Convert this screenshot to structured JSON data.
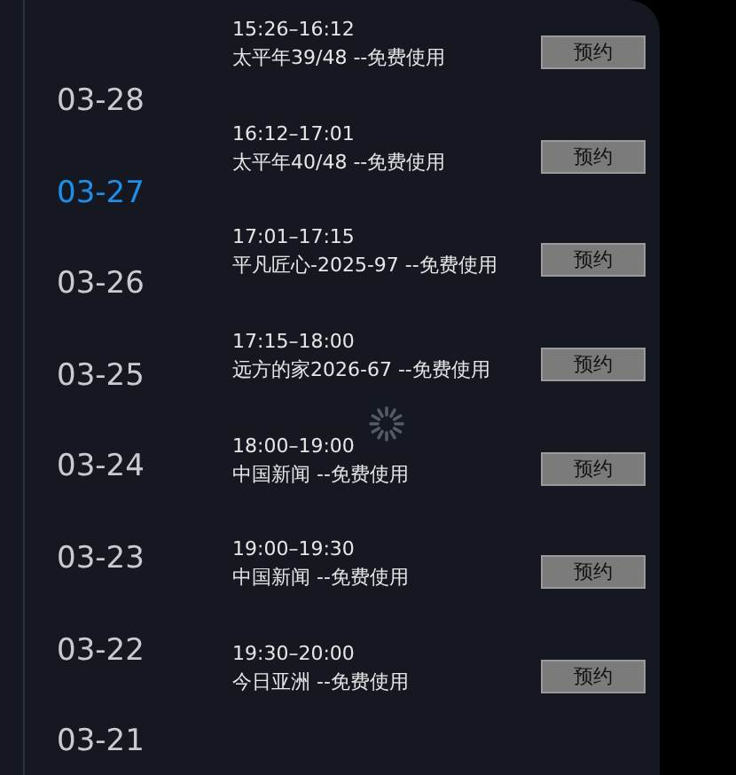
{
  "dates": [
    {
      "label": "03-28",
      "selected": false
    },
    {
      "label": "03-27",
      "selected": true
    },
    {
      "label": "03-26",
      "selected": false
    },
    {
      "label": "03-25",
      "selected": false
    },
    {
      "label": "03-24",
      "selected": false
    },
    {
      "label": "03-23",
      "selected": false
    },
    {
      "label": "03-22",
      "selected": false
    },
    {
      "label": "03-21",
      "selected": false
    }
  ],
  "programs": [
    {
      "time": "15:26–16:12",
      "title": "太平年39/48 --免费使用",
      "button": "预约"
    },
    {
      "time": "16:12–17:01",
      "title": "太平年40/48 --免费使用",
      "button": "预约"
    },
    {
      "time": "17:01–17:15",
      "title": "平凡匠心-2025-97 --免费使用",
      "button": "预约"
    },
    {
      "time": "17:15–18:00",
      "title": "远方的家2026-67 --免费使用",
      "button": "预约"
    },
    {
      "time": "18:00–19:00",
      "title": "中国新闻 --免费使用",
      "button": "预约"
    },
    {
      "time": "19:00–19:30",
      "title": "中国新闻 --免费使用",
      "button": "预约"
    },
    {
      "time": "19:30–20:00",
      "title": "今日亚洲 --免费使用",
      "button": "预约"
    }
  ],
  "loading": true
}
